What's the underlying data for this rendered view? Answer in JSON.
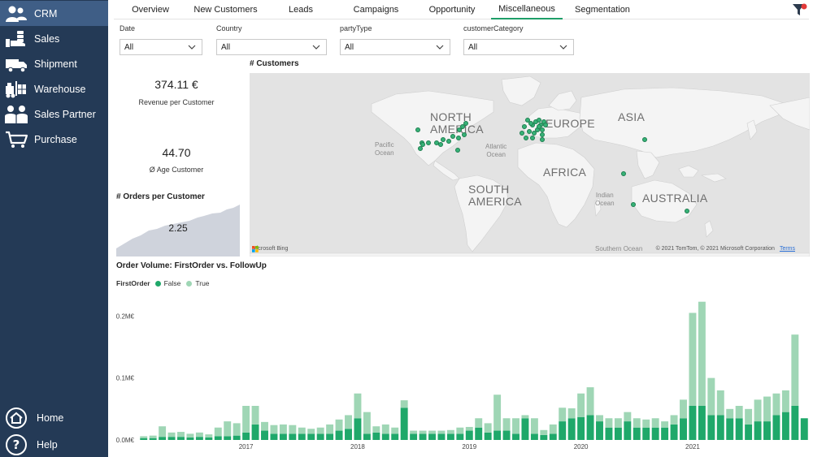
{
  "sidebar": {
    "items": [
      {
        "label": "CRM",
        "icon": "users-icon",
        "active": true
      },
      {
        "label": "Sales",
        "icon": "hand-coins-icon"
      },
      {
        "label": "Shipment",
        "icon": "truck-icon"
      },
      {
        "label": "Warehouse",
        "icon": "forklift-icon"
      },
      {
        "label": "Sales Partner",
        "icon": "partners-icon"
      },
      {
        "label": "Purchase",
        "icon": "cart-icon"
      }
    ],
    "bottom": [
      {
        "label": "Home",
        "icon": "home-icon"
      },
      {
        "label": "Help",
        "icon": "help-icon"
      }
    ]
  },
  "tabs": [
    {
      "label": "Overview"
    },
    {
      "label": "New Customers"
    },
    {
      "label": "Leads"
    },
    {
      "label": "Campaigns"
    },
    {
      "label": "Opportunity"
    },
    {
      "label": "Miscellaneous",
      "active": true
    },
    {
      "label": "Segmentation"
    }
  ],
  "filters": [
    {
      "label": "Date",
      "value": "All"
    },
    {
      "label": "Country",
      "value": "All"
    },
    {
      "label": "partyType",
      "value": "All"
    },
    {
      "label": "customerCategory",
      "value": "All"
    }
  ],
  "kpis": {
    "revenue": {
      "value": "374.11 €",
      "label": "Revenue per Customer"
    },
    "age": {
      "value": "44.70",
      "label": "Ø Age Customer"
    },
    "orders": {
      "title": "# Orders per Customer",
      "value": "2.25"
    }
  },
  "map": {
    "title": "# Customers",
    "continents": [
      "NORTH\nAMERICA",
      "EUROPE",
      "ASIA",
      "AFRICA",
      "SOUTH\nAMERICA",
      "AUSTRALIA"
    ],
    "oceans": [
      "Pacific\nOcean",
      "Atlantic\nOcean",
      "Indian\nOcean",
      "Southern Ocean"
    ],
    "attribution_left": "Microsoft Bing",
    "attribution_right": "© 2021 TomTom, © 2021 Microsoft Corporation",
    "terms": "Terms"
  },
  "chart_data": {
    "type": "bar",
    "stacked": true,
    "title": "Order Volume: FirstOrder vs. FollowUp",
    "legend_title": "FirstOrder",
    "legend_position": "top-left",
    "ylim": [
      0,
      0.22
    ],
    "yticks": [
      0,
      0.1,
      0.2
    ],
    "ytick_labels": [
      "0.0M€",
      "0.1M€",
      "0.2M€"
    ],
    "xtick_labels": [
      "2017",
      "2018",
      "2019",
      "2020",
      "2021"
    ],
    "xtick_index": [
      11,
      23,
      35,
      47,
      59
    ],
    "series": [
      {
        "name": "False",
        "color": "#1fa86a",
        "values": [
          0.003,
          0.003,
          0.005,
          0.005,
          0.005,
          0.004,
          0.005,
          0.004,
          0.006,
          0.006,
          0.007,
          0.012,
          0.025,
          0.015,
          0.01,
          0.01,
          0.01,
          0.01,
          0.01,
          0.01,
          0.01,
          0.015,
          0.018,
          0.035,
          0.01,
          0.012,
          0.01,
          0.01,
          0.052,
          0.01,
          0.01,
          0.01,
          0.01,
          0.01,
          0.01,
          0.015,
          0.02,
          0.012,
          0.015,
          0.015,
          0.01,
          0.035,
          0.01,
          0.008,
          0.01,
          0.03,
          0.035,
          0.037,
          0.04,
          0.03,
          0.02,
          0.02,
          0.03,
          0.02,
          0.02,
          0.02,
          0.02,
          0.025,
          0.035,
          0.055,
          0.055,
          0.04,
          0.04,
          0.035,
          0.035,
          0.025,
          0.03,
          0.03,
          0.04,
          0.045,
          0.055,
          0.035
        ]
      },
      {
        "name": "True",
        "color": "#9fd6b5",
        "values": [
          0.003,
          0.004,
          0.017,
          0.007,
          0.008,
          0.006,
          0.007,
          0.005,
          0.014,
          0.024,
          0.02,
          0.043,
          0.03,
          0.014,
          0.014,
          0.015,
          0.014,
          0.01,
          0.008,
          0.01,
          0.015,
          0.018,
          0.022,
          0.04,
          0.035,
          0.01,
          0.015,
          0.01,
          0.012,
          0.005,
          0.005,
          0.005,
          0.005,
          0.006,
          0.01,
          0.006,
          0.015,
          0.015,
          0.058,
          0.02,
          0.025,
          0.005,
          0.025,
          0.008,
          0.015,
          0.022,
          0.016,
          0.038,
          0.045,
          0.01,
          0.015,
          0.015,
          0.015,
          0.015,
          0.013,
          0.015,
          0.01,
          0.015,
          0.03,
          0.15,
          0.168,
          0.06,
          0.04,
          0.015,
          0.02,
          0.025,
          0.035,
          0.04,
          0.035,
          0.035,
          0.115,
          0.0
        ]
      }
    ]
  }
}
